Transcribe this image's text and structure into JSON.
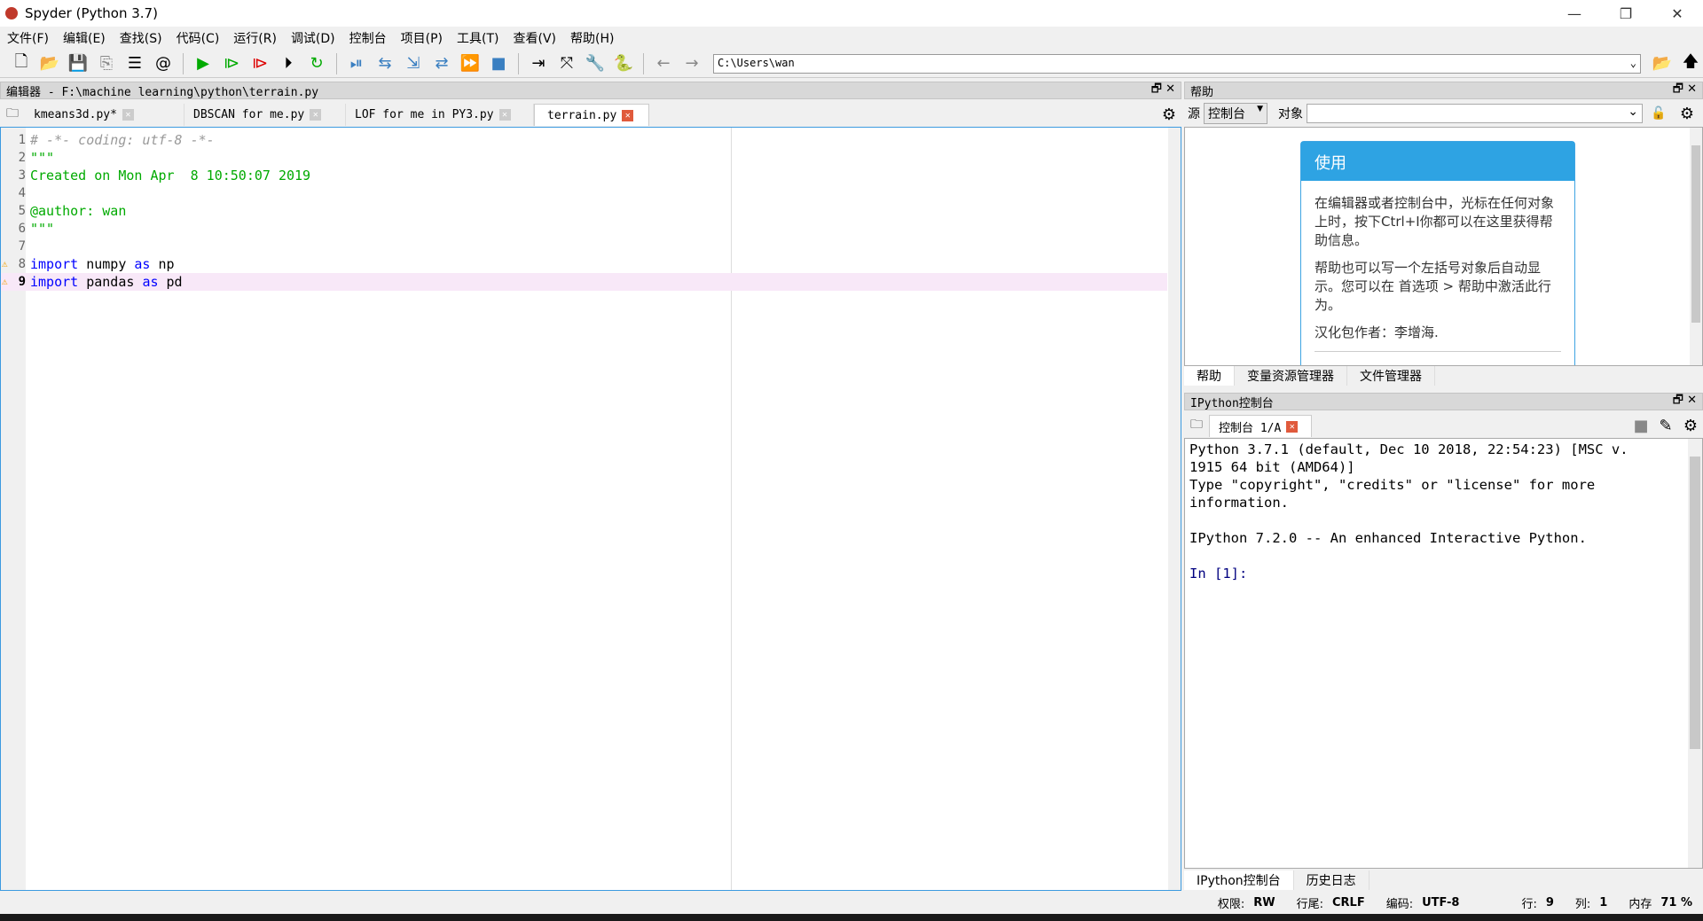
{
  "window": {
    "title": "Spyder (Python 3.7)",
    "minimize": "—",
    "maximize": "❐",
    "close": "✕"
  },
  "menu": [
    "文件(F)",
    "编辑(E)",
    "查找(S)",
    "代码(C)",
    "运行(R)",
    "调试(D)",
    "控制台",
    "项目(P)",
    "工具(T)",
    "查看(V)",
    "帮助(H)"
  ],
  "toolbar": {
    "path": "C:\\Users\\wan"
  },
  "editor": {
    "header": "编辑器 - F:\\machine learning\\python\\terrain.py",
    "tabs": [
      "kmeans3d.py*",
      "DBSCAN for me.py",
      "LOF for me in PY3.py",
      "terrain.py"
    ],
    "lines": [
      "# -*- coding: utf-8 -*-",
      "\"\"\"",
      "Created on Mon Apr  8 10:50:07 2019",
      "",
      "@author: wan",
      "\"\"\"",
      "",
      "import numpy as np",
      "import pandas as pd"
    ],
    "current_line": 9
  },
  "help": {
    "header": "帮助",
    "source_label": "源",
    "source_value": "控制台",
    "object_label": "对象",
    "object_value": "",
    "card_title": "使用",
    "p1": "在编辑器或者控制台中，光标在任何对象上时，按下Ctrl+I你都可以在这里获得帮助信息。",
    "p2": "帮助也可以写一个左括号对象后自动显示。您可以在 首选项 > 帮助中激活此行为。",
    "p3": "汉化包作者：李增海.",
    "tabs": [
      "帮助",
      "变量资源管理器",
      "文件管理器"
    ]
  },
  "console": {
    "header": "IPython控制台",
    "tab": "控制台 1/A",
    "text": "Python 3.7.1 (default, Dec 10 2018, 22:54:23) [MSC v.\n1915 64 bit (AMD64)]\nType \"copyright\", \"credits\" or \"license\" for more\ninformation.\n\nIPython 7.2.0 -- An enhanced Interactive Python.\n\n",
    "prompt": "In [1]:",
    "tabs": [
      "IPython控制台",
      "历史日志"
    ]
  },
  "status": {
    "perm_label": "权限:",
    "perm": "RW",
    "eol_label": "行尾:",
    "eol": "CRLF",
    "enc_label": "编码:",
    "enc": "UTF-8",
    "line_label": "行:",
    "line": "9",
    "col_label": "列:",
    "col": "1",
    "mem_label": "内存",
    "mem": "71 %"
  }
}
